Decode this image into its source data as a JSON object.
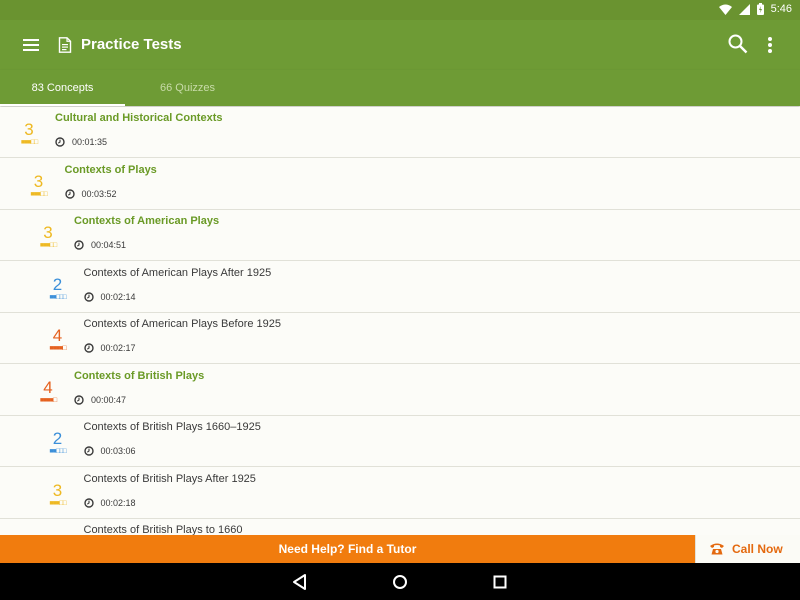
{
  "status_bar": {
    "time": "5:46",
    "icons": [
      "wifi-icon",
      "cell-signal-icon",
      "battery-icon"
    ]
  },
  "app_bar": {
    "title": "Practice Tests",
    "icons": [
      "menu-icon",
      "document-icon",
      "search-icon",
      "more-vert-icon"
    ]
  },
  "tabs": [
    {
      "label": "83 Concepts",
      "selected": true
    },
    {
      "label": "66 Quizzes",
      "selected": false
    }
  ],
  "colors": {
    "primary": "#6e9b35",
    "status_bar": "#6a9330",
    "accent_orange": "#f17c0e",
    "level_2": "#3b8fd9",
    "level_3": "#eeb923",
    "level_4": "#e5611f",
    "concept_green": "#6a9a26"
  },
  "concepts": [
    {
      "level": "3",
      "title": "Cultural and Historical Contexts",
      "time": "00:01:35",
      "indent": 0,
      "bold": true
    },
    {
      "level": "3",
      "title": "Contexts of Plays",
      "time": "00:03:52",
      "indent": 1,
      "bold": true
    },
    {
      "level": "3",
      "title": "Contexts of American Plays",
      "time": "00:04:51",
      "indent": 2,
      "bold": true
    },
    {
      "level": "2",
      "title": "Contexts of American Plays After 1925",
      "time": "00:02:14",
      "indent": 3,
      "bold": false
    },
    {
      "level": "4",
      "title": "Contexts of American Plays Before 1925",
      "time": "00:02:17",
      "indent": 3,
      "bold": false
    },
    {
      "level": "4",
      "title": "Contexts of British Plays",
      "time": "00:00:47",
      "indent": 2,
      "bold": true
    },
    {
      "level": "2",
      "title": "Contexts of British Plays 1660–1925",
      "time": "00:03:06",
      "indent": 3,
      "bold": false
    },
    {
      "level": "3",
      "title": "Contexts of British Plays After 1925",
      "time": "00:02:18",
      "indent": 3,
      "bold": false
    },
    {
      "level": "",
      "title": "Contexts of British Plays to 1660",
      "time": "",
      "indent": 3,
      "bold": false
    }
  ],
  "help_bar": {
    "label": "Need Help? Find a Tutor",
    "call_label": "Call Now",
    "call_icon": "phone-icon"
  },
  "nav_bar": {
    "icons": [
      "back-icon",
      "home-icon",
      "recents-icon"
    ]
  }
}
